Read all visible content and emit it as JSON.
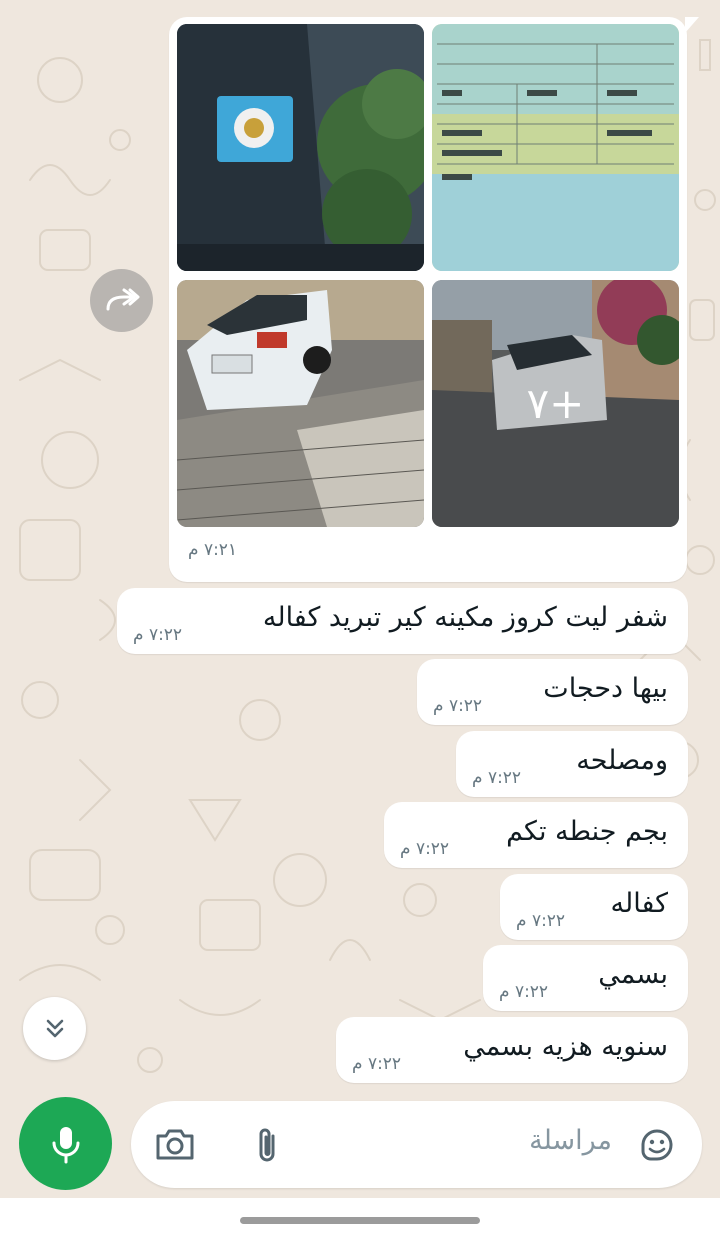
{
  "chat": {
    "media_group": {
      "time": "٧:٢١ م",
      "more_count": "٧+"
    },
    "messages": [
      {
        "text": "شفر ليت كروز مكينه كير تبريد كفاله",
        "time": "٧:٢٢ م"
      },
      {
        "text": "بيها دحجات",
        "time": "٧:٢٢ م"
      },
      {
        "text": "ومصلحه",
        "time": "٧:٢٢ م"
      },
      {
        "text": "بجم جنطه تكم",
        "time": "٧:٢٢ م"
      },
      {
        "text": "كفاله",
        "time": "٧:٢٢ م"
      },
      {
        "text": "بسمي",
        "time": "٧:٢٢ م"
      },
      {
        "text": "سنويه هزيه بسمي",
        "time": "٧:٢٢ م"
      }
    ]
  },
  "composer": {
    "placeholder": "مراسلة"
  },
  "icons": {
    "forward": "forward-icon",
    "scroll_down": "double-chevron-down-icon",
    "sticker": "sticker-icon",
    "attach": "paperclip-icon",
    "camera": "camera-icon",
    "mic": "microphone-icon"
  },
  "colors": {
    "background": "#efe7de",
    "bubble": "#ffffff",
    "mic_button": "#1da855",
    "timestamp": "#667781"
  }
}
